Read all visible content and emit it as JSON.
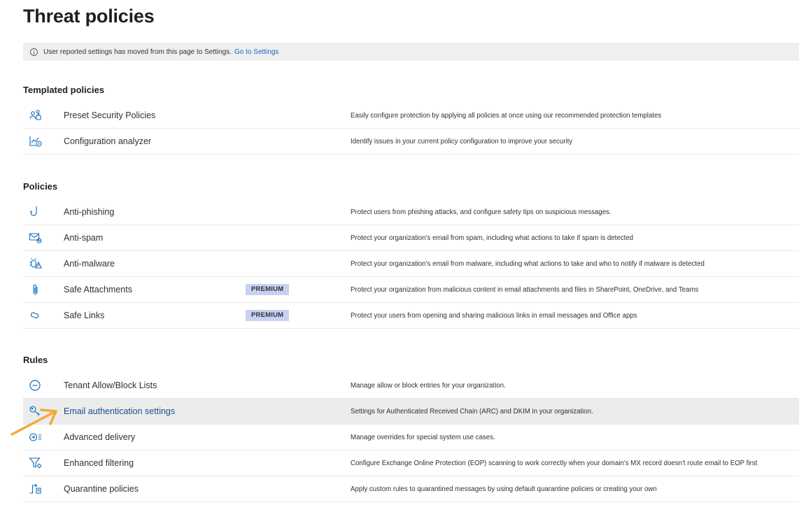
{
  "page": {
    "title": "Threat policies"
  },
  "banner": {
    "text": "User reported settings has moved from this page to Settings.",
    "link": "Go to Settings",
    "icon": "info-icon"
  },
  "sections": {
    "templated": {
      "title": "Templated policies",
      "items": [
        {
          "name": "Preset Security Policies",
          "icon": "users-shield-icon",
          "desc": "Easily configure protection by applying all policies at once using our recommended protection templates"
        },
        {
          "name": "Configuration analyzer",
          "icon": "chart-info-icon",
          "desc": "Identify issues in your current policy configuration to improve your security"
        }
      ]
    },
    "policies": {
      "title": "Policies",
      "items": [
        {
          "name": "Anti-phishing",
          "icon": "hook-icon",
          "desc": "Protect users from phishing attacks, and configure safety tips on suspicious messages."
        },
        {
          "name": "Anti-spam",
          "icon": "mail-block-icon",
          "desc": "Protect your organization's email from spam, including what actions to take if spam is detected"
        },
        {
          "name": "Anti-malware",
          "icon": "bug-warning-icon",
          "desc": "Protect your organization's email from malware, including what actions to take and who to notify if malware is detected"
        },
        {
          "name": "Safe Attachments",
          "icon": "paperclip-icon",
          "badge": "PREMIUM",
          "desc": "Protect your organization from malicious content in email attachments and files in SharePoint, OneDrive, and Teams"
        },
        {
          "name": "Safe Links",
          "icon": "link-icon",
          "badge": "PREMIUM",
          "desc": "Protect your users from opening and sharing malicious links in email messages and Office apps"
        }
      ]
    },
    "rules": {
      "title": "Rules",
      "items": [
        {
          "name": "Tenant Allow/Block Lists",
          "icon": "block-circle-icon",
          "desc": "Manage allow or block entries for your organization."
        },
        {
          "name": "Email authentication settings",
          "icon": "key-icon",
          "desc": "Settings for Authenticated Received Chain (ARC) and DKIM in your organization."
        },
        {
          "name": "Advanced delivery",
          "icon": "delivery-list-icon",
          "desc": "Manage overrides for special system use cases."
        },
        {
          "name": "Enhanced filtering",
          "icon": "filter-gear-icon",
          "desc": "Configure Exchange Online Protection (EOP) scanning to work correctly when your domain's MX record doesn't route email to EOP first"
        },
        {
          "name": "Quarantine policies",
          "icon": "quarantine-icon",
          "desc": "Apply custom rules to quarantined messages by using default quarantine policies or creating your own"
        }
      ]
    }
  },
  "colors": {
    "accent": "#0f6cbd",
    "badge_bg": "#c7d2f3",
    "arrow": "#f2a93b",
    "highlight": "#ececec"
  }
}
